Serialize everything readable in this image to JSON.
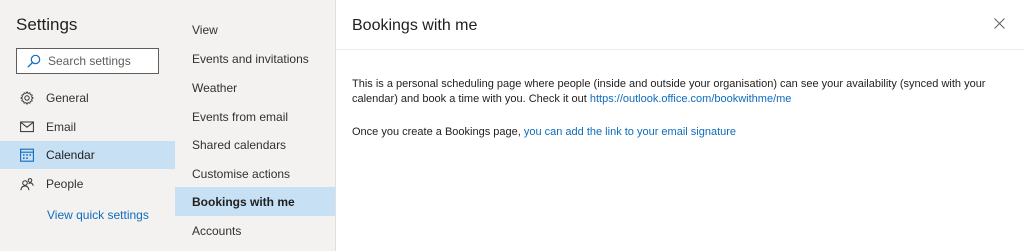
{
  "settings": {
    "title": "Settings",
    "search_placeholder": "Search settings"
  },
  "nav": {
    "items": [
      {
        "label": "General",
        "icon": "gear-icon"
      },
      {
        "label": "Email",
        "icon": "mail-icon"
      },
      {
        "label": "Calendar",
        "icon": "calendar-icon",
        "active": true
      },
      {
        "label": "People",
        "icon": "people-icon"
      }
    ],
    "quick_settings": "View quick settings"
  },
  "subnav": {
    "items": [
      {
        "label": "View"
      },
      {
        "label": "Events and invitations"
      },
      {
        "label": "Weather"
      },
      {
        "label": "Events from email"
      },
      {
        "label": "Shared calendars"
      },
      {
        "label": "Customise actions"
      },
      {
        "label": "Bookings with me",
        "active": true
      },
      {
        "label": "Accounts"
      }
    ]
  },
  "content": {
    "title": "Bookings with me",
    "paragraph1_text": "This is a personal scheduling page where people (inside and outside your organisation) can see your availability (synced with your calendar) and book a time with you. Check it out ",
    "paragraph1_link": "https://outlook.office.com/bookwithme/me",
    "paragraph2_text": "Once you create a Bookings page, ",
    "paragraph2_link": "you can add the link to your email signature"
  },
  "colors": {
    "accent": "#0f6cbd",
    "selected_bg": "#c7e0f4",
    "pane_bg": "#f3f2f1"
  }
}
